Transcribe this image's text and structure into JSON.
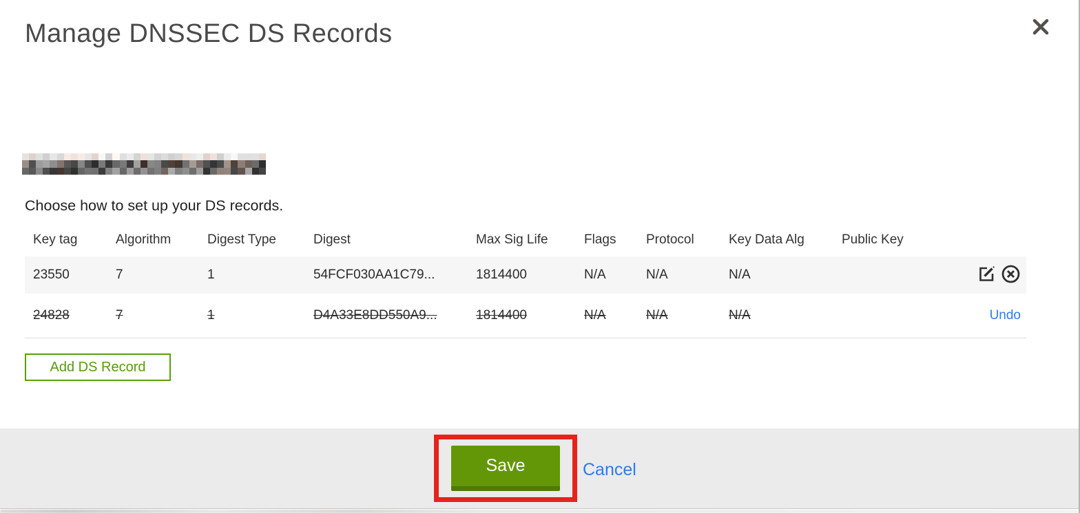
{
  "modal": {
    "title": "Manage DNSSEC DS Records",
    "close_icon": "x-close",
    "domain_redacted": true,
    "intro": "Choose how to set up your DS records."
  },
  "table": {
    "headers": {
      "key_tag": "Key tag",
      "algorithm": "Algorithm",
      "digest_type": "Digest Type",
      "digest": "Digest",
      "max_sig_life": "Max Sig Life",
      "flags": "Flags",
      "protocol": "Protocol",
      "key_data_alg": "Key Data Alg",
      "public_key": "Public Key"
    },
    "rows": [
      {
        "key_tag": "23550",
        "algorithm": "7",
        "digest_type": "1",
        "digest": "54FCF030AA1C79...",
        "max_sig_life": "1814400",
        "flags": "N/A",
        "protocol": "N/A",
        "key_data_alg": "N/A",
        "public_key": "",
        "state": "current",
        "actions": [
          "edit",
          "delete"
        ]
      },
      {
        "key_tag": "24828",
        "algorithm": "7",
        "digest_type": "1",
        "digest": "D4A33E8DD550A9...",
        "max_sig_life": "1814400",
        "flags": "N/A",
        "protocol": "N/A",
        "key_data_alg": "N/A",
        "public_key": "",
        "state": "marked-for-deletion",
        "undo_label": "Undo"
      }
    ]
  },
  "buttons": {
    "add_ds_record": "Add DS Record",
    "save": "Save",
    "cancel": "Cancel"
  },
  "annotation": {
    "type": "red-rectangle-highlight",
    "target": "save-button",
    "color": "#e6231b"
  },
  "colors": {
    "primary_green": "#639708",
    "green_border": "#57a00a",
    "link_blue": "#2d7bf2",
    "footer_gray": "#ebebeb",
    "row_stripe_gray": "#f6f6f6",
    "title_gray": "#4a4a4a"
  }
}
